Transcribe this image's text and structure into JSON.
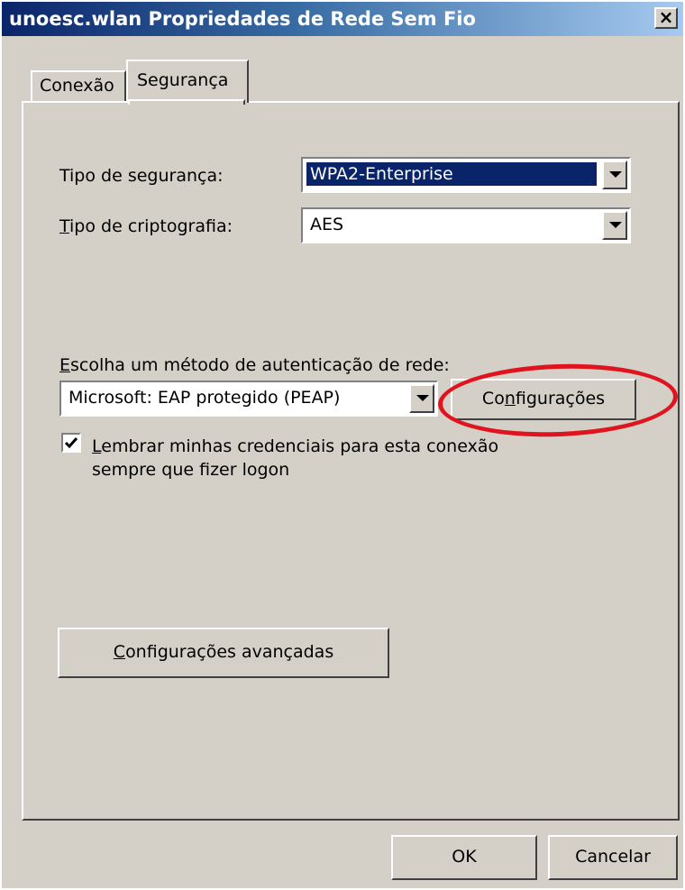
{
  "window": {
    "title": "unoesc.wlan Propriedades de Rede Sem Fio",
    "close_label": "×"
  },
  "tabs": {
    "conexao": "Conexão",
    "seguranca": "Segurança"
  },
  "security": {
    "type_label_prefix": "",
    "type_label_mnemonic": "",
    "type_label_rest": "Tipo de segurança:",
    "type_value": "WPA2-Enterprise",
    "crypto_label_mnemonic": "T",
    "crypto_label_rest": "ipo de criptografia:",
    "crypto_value": "AES",
    "auth_label_mnemonic": "E",
    "auth_label_rest": "scolha um método de autenticação de rede:",
    "auth_value": "Microsoft: EAP protegido (PEAP)",
    "settings_button_prefix": "Co",
    "settings_button_mnemonic": "n",
    "settings_button_rest": "figurações",
    "remember_checked": true,
    "remember_mnemonic": "L",
    "remember_line1_rest": "embrar minhas credenciais para esta conexão",
    "remember_line2": "sempre que fizer logon",
    "advanced_button_mnemonic": "C",
    "advanced_button_rest": "onfigurações avançadas"
  },
  "footer": {
    "ok_label": "OK",
    "cancel_label": "Cancelar"
  },
  "colors": {
    "highlight_circle": "#e0141e",
    "selection": "#0a246a"
  }
}
